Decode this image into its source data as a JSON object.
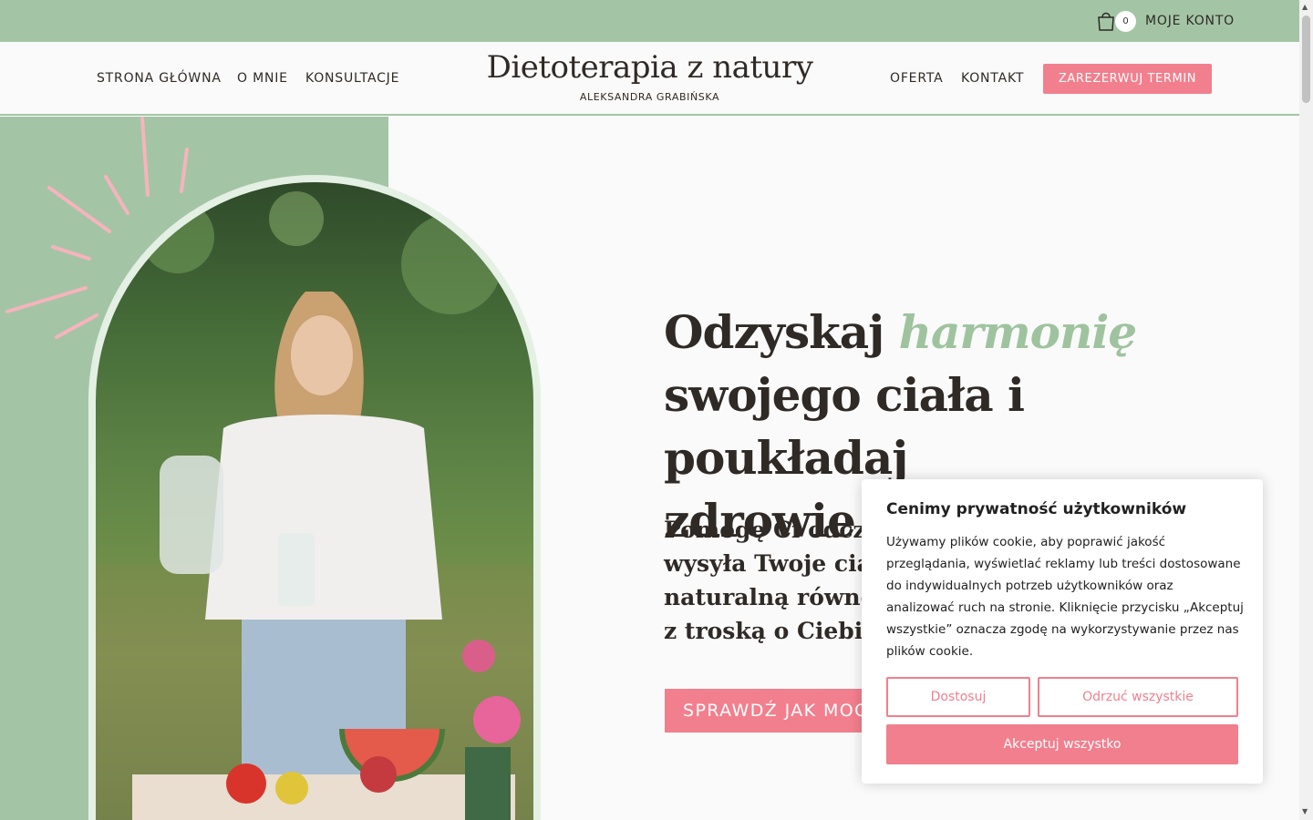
{
  "topbar": {
    "cart_count": "0",
    "account_label": "MOJE KONTO"
  },
  "nav": {
    "left_links": [
      "STRONA GŁÓWNA",
      "O MNIE",
      "KONSULTACJE"
    ],
    "logo_title": "Dietoterapia z natury",
    "logo_subtitle": "ALEKSANDRA GRABIŃSKA",
    "right_links": [
      "OFERTA",
      "KONTAKT"
    ],
    "book_button": "ZAREZERWUJ TERMIN"
  },
  "hero": {
    "title_line1_prefix": "Odzyskaj",
    "title_accent": "harmonię",
    "title_line2": "swojego ciała i poukładaj",
    "title_line3": "zdrowie od środka",
    "subtitle_lines": [
      "Pomogę Ci odczyt",
      "wysyła Twoje ciał",
      "naturalną równov",
      "z troską o Ciebie c"
    ],
    "cta_label": "SPRAWDŹ JAK MOG"
  },
  "cookie": {
    "title": "Cenimy prywatność użytkowników",
    "text": "Używamy plików cookie, aby poprawić jakość przeglądania, wyświetlać reklamy lub treści dostosowane do indywidualnych potrzeb użytkowników oraz analizować ruch na stronie. Kliknięcie przycisku „Akceptuj wszystkie” oznacza zgodę na wykorzystywanie przez nas plików cookie.",
    "customize_label": "Dostosuj",
    "reject_label": "Odrzuć wszystkie",
    "accept_label": "Akceptuj wszystko"
  },
  "colors": {
    "green": "#a3c5a5",
    "pink": "#f27f8d",
    "text": "#2f2a26",
    "background": "#fafafa"
  }
}
